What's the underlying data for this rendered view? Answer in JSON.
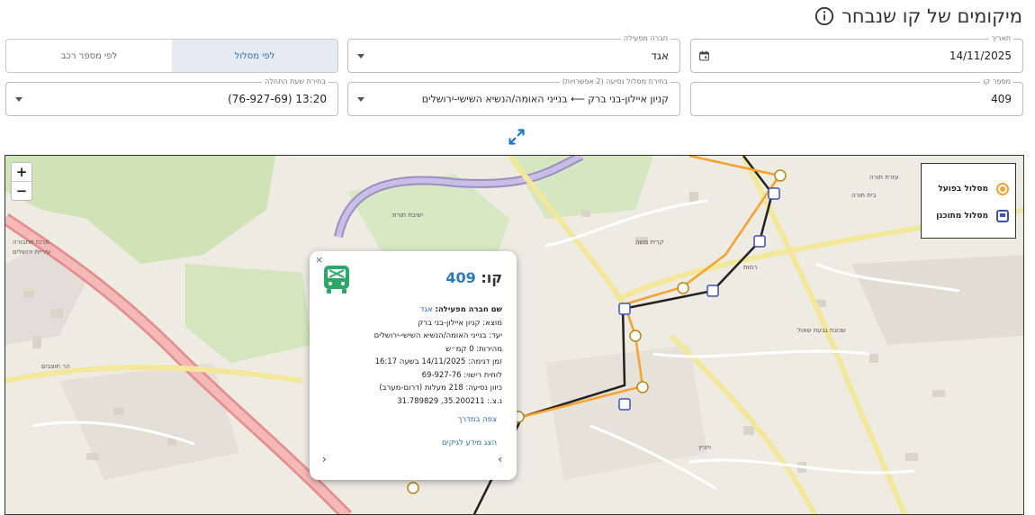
{
  "page": {
    "title": "מיקומים של קו שנבחר",
    "info_icon": "info-circle-icon"
  },
  "filters": {
    "date": {
      "label": "תאריך",
      "value": "14/11/2025",
      "icon": "calendar-icon"
    },
    "operator": {
      "label": "חברה מפעילה",
      "value": "אגד"
    },
    "mode_toggle": {
      "by_route": "לפי מסלול",
      "by_vehicle": "לפי מספר רכב",
      "active": "by_route"
    },
    "line_number": {
      "label": "מספר קו",
      "value": "409"
    },
    "route": {
      "label": "בחירת מסלול נסיעה (2 אפשרויות)",
      "value": "קניון איילון-בני ברק ⟵ בנייני האומה/הנשיא השישי-ירושלים"
    },
    "start_time": {
      "label": "בחירת שעת התחלה",
      "value": "13:20 (76-927-69)"
    }
  },
  "map": {
    "zoom_in": "+",
    "zoom_out": "−",
    "expand_icon": "expand-arrows-icon",
    "legend": {
      "actual": "מסלול בפועל",
      "planned": "מסלול מתוכנן"
    },
    "colors": {
      "actual": "#f7a130",
      "planned": "#222222",
      "bus_stop": "#3f51b5"
    },
    "labels": [
      "מרכז תחבורה",
      "עיריית ירושלים",
      "קרית משה",
      "שכונת גבעת שאול",
      "הר חוצבים",
      "רמות",
      "ישיבת תורת",
      "בית תורה",
      "עזרת תורה",
      "ויזניץ"
    ]
  },
  "popup": {
    "line_label": "קו:",
    "line_number": "409",
    "operator_label": "שם חברה מפעילה:",
    "operator_value": "אגד",
    "origin": "מוצא: קניון איילון-בני ברק",
    "destination": "יעד: בנייני האומה/הנשיא השישי-ירושלים",
    "speed": "מהירות: 0 קמ״ש",
    "sample_time": "זמן דגימה: 14/11/2025 בשעה 16:17",
    "plate": "לוחית רישוי: 69-927-76",
    "heading": "כיוון נסיעה: 218 מעלות (דרום-מערב)",
    "coords": "נ.צ.: 35.200211, 31.789829",
    "street_view": "צפה במדרך",
    "more_info": "הצג מידע לגיקים",
    "close": "×",
    "prev": "‹",
    "next": "›"
  }
}
